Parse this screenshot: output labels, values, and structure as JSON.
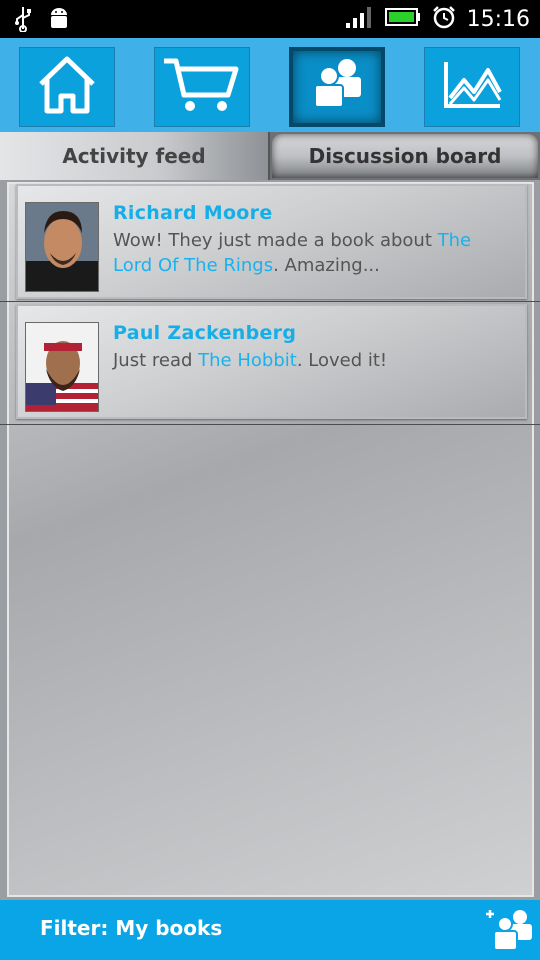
{
  "statusbar": {
    "time": "15:16"
  },
  "nav": {
    "items": [
      {
        "icon": "home-icon"
      },
      {
        "icon": "cart-icon"
      },
      {
        "icon": "friends-icon",
        "active": true
      },
      {
        "icon": "stats-icon"
      }
    ]
  },
  "tabs": {
    "activity_feed": "Activity feed",
    "discussion_board": "Discussion board"
  },
  "posts": [
    {
      "author": "Richard Moore",
      "text_before": "Wow! They just made a book about ",
      "link": "The Lord Of The Rings",
      "text_after": ". Amazing..."
    },
    {
      "author": "Paul Zackenberg",
      "text_before": "Just read ",
      "link": "The Hobbit",
      "text_after": ". Loved it!"
    }
  ],
  "footer": {
    "filter": "Filter: My books"
  },
  "colors": {
    "accent": "#0aa5e6",
    "link": "#19b2ee",
    "navbar": "#3fb0e8"
  }
}
